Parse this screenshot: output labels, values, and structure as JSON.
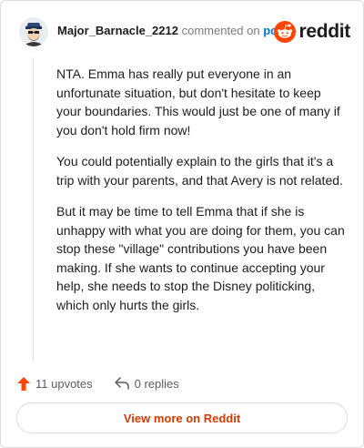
{
  "header": {
    "username": "Major_Barnacle_2212",
    "commented_on": "commented on",
    "post_link": "post",
    "brand_name": "reddit"
  },
  "comment": {
    "paragraphs": [
      "NTA. Emma has really put everyone in an unfortunate situation, but don't hesitate to keep your boundaries. This would just be one of many if you don't hold firm now!",
      "You could potentially explain to the girls that it's a trip with your parents, and that Avery is not related.",
      "But it may be time to tell Emma that if she is unhappy with what you are doing for them, you can stop these \"village\" contributions you have been making. If she wants to continue accepting your help, she needs to stop the Disney politicking, which only hurts the girls."
    ]
  },
  "actions": {
    "upvotes": "11 upvotes",
    "replies": "0 replies"
  },
  "footer": {
    "view_more": "View more on Reddit"
  },
  "colors": {
    "accent": "#ff4500",
    "link": "#0079d3",
    "view_more_text": "#d93900"
  },
  "icons": [
    "avatar-icon",
    "reddit-logo-icon",
    "upvote-arrow-icon",
    "reply-arrow-icon"
  ]
}
